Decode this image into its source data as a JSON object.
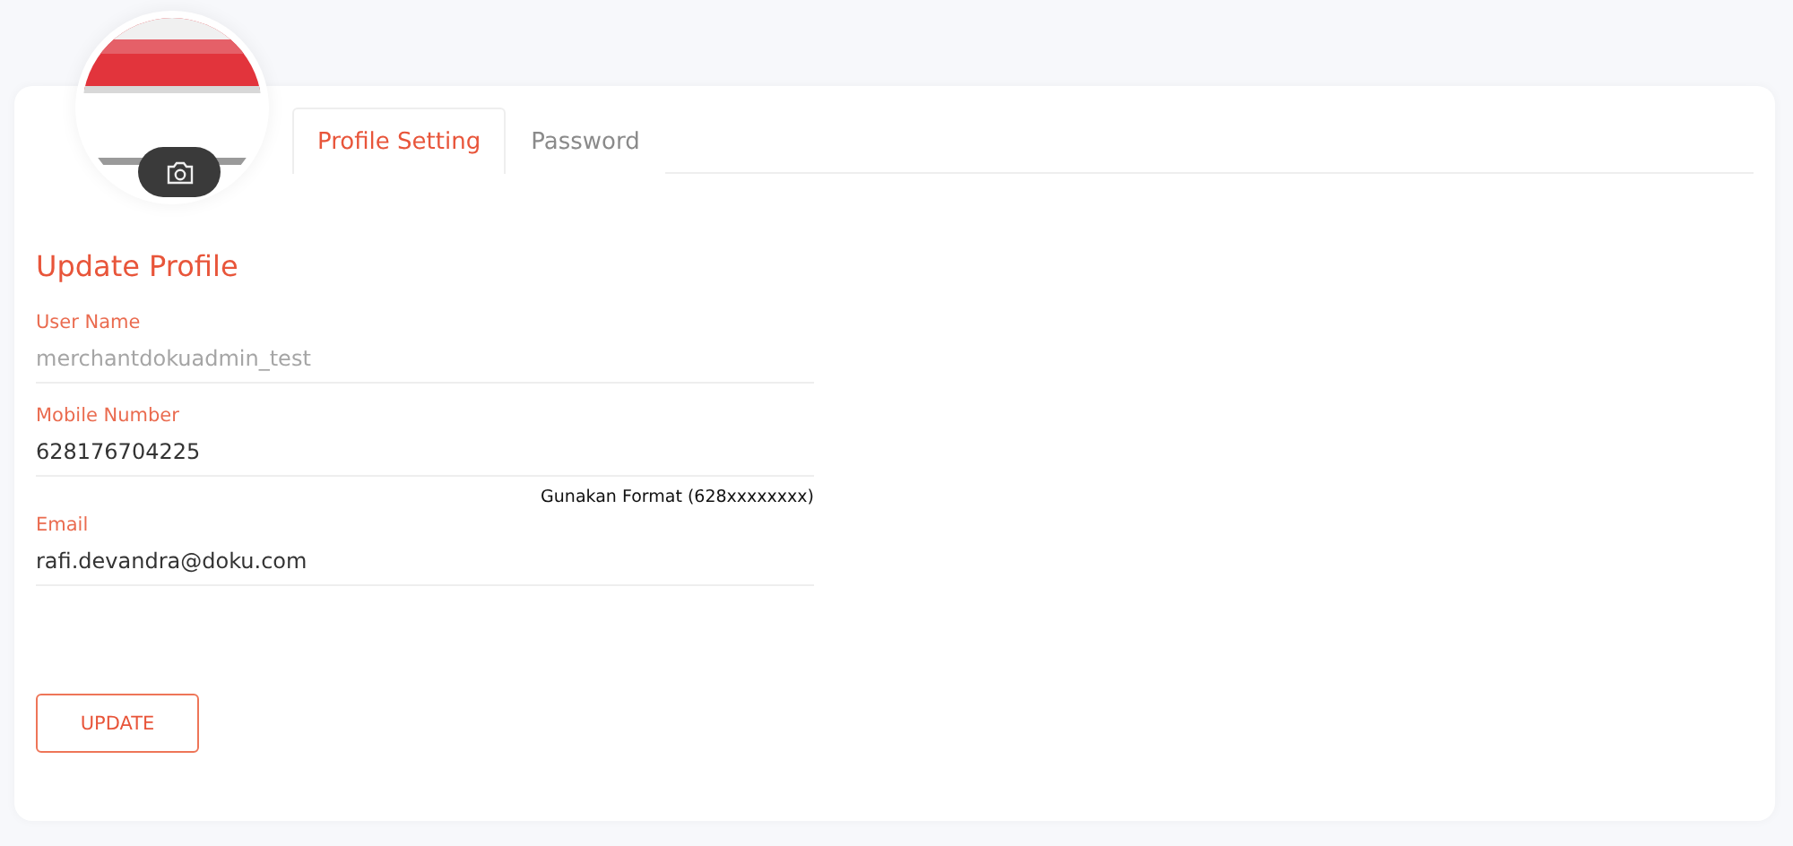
{
  "tabs": [
    {
      "label": "Profile Setting",
      "selected": true
    },
    {
      "label": "Password",
      "selected": false
    }
  ],
  "form": {
    "title": "Update Profile",
    "fields": [
      {
        "label": "User Name",
        "value": "merchantdokuadmin_test",
        "disabled": true
      },
      {
        "label": "Mobile Number",
        "value": "628176704225",
        "disabled": false,
        "hint": "Gunakan Format (628xxxxxxxx)"
      },
      {
        "label": "Email",
        "value": "rafi.devandra@doku.com",
        "disabled": false
      }
    ],
    "submit": "UPDATE"
  }
}
